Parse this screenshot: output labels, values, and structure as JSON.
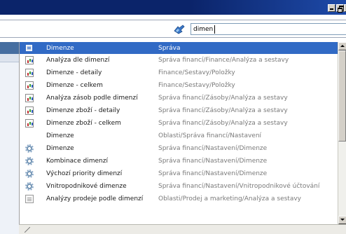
{
  "search": {
    "value": "dimen"
  },
  "dropdown": {
    "columns": {
      "name": "Dimenze",
      "path": "Správa"
    },
    "rows": [
      {
        "icon": "report-icon",
        "name": "Analýza dle dimenzí",
        "path": "Správa financí/Finance/Analýza a sestavy"
      },
      {
        "icon": "report-icon",
        "name": "Dimenze - detaily",
        "path": "Finance/Sestavy/Položky"
      },
      {
        "icon": "report-icon",
        "name": "Dimenze - celkem",
        "path": "Finance/Sestavy/Položky"
      },
      {
        "icon": "report-icon",
        "name": "Analýza zásob podle dimenzí",
        "path": "Správa financí/Zásoby/Analýza a sestavy"
      },
      {
        "icon": "report-icon",
        "name": "Dimenze zboží - detaily",
        "path": "Správa financí/Zásoby/Analýza a sestavy"
      },
      {
        "icon": "report-icon",
        "name": "Dimenze zboží - celkem",
        "path": "Správa financí/Zásoby/Analýza a sestavy"
      },
      {
        "icon": "",
        "name": "Dimenze",
        "path": "Oblasti/Správa financí/Nastavení"
      },
      {
        "icon": "gear-icon",
        "name": "Dimenze",
        "path": "Správa financí/Nastavení/Dimenze"
      },
      {
        "icon": "gear-icon",
        "name": "Kombinace dimenzí",
        "path": "Správa financí/Nastavení/Dimenze"
      },
      {
        "icon": "gear-icon",
        "name": "Výchozí priority dimenzí",
        "path": "Správa financí/Nastavení/Dimenze"
      },
      {
        "icon": "gear-icon",
        "name": "Vnitropodnikové dimenze",
        "path": "Správa financí/Nastavení/Vnitropodnikové účtování"
      },
      {
        "icon": "document-icon",
        "name": "Analýzy prodeje podle dimenzí",
        "path": "Oblasti/Prodej a marketing/Analýza a sestavy"
      }
    ]
  },
  "colors": {
    "selection": "#316ac5",
    "titlebar": "#0b246a",
    "path_text": "#7a7a7a"
  }
}
